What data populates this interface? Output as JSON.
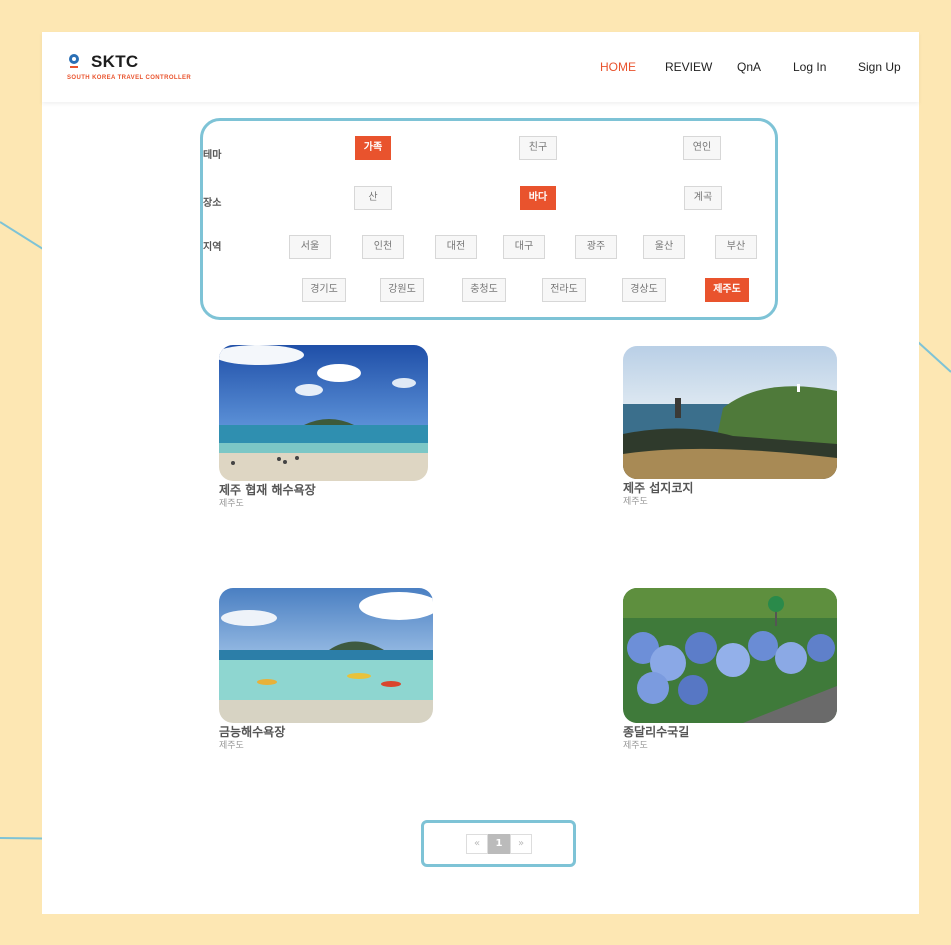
{
  "header": {
    "logo_title": "SKTC",
    "logo_subtitle": "SOUTH KOREA TRAVEL CONTROLLER",
    "nav": {
      "home": "HOME",
      "review": "REVIEW",
      "qna": "QnA",
      "login": "Log In",
      "signup": "Sign Up"
    },
    "active_nav": "HOME"
  },
  "filters": {
    "theme": {
      "label": "테마",
      "options": [
        "가족",
        "친구",
        "연인"
      ],
      "selected": "가족"
    },
    "place": {
      "label": "장소",
      "options": [
        "산",
        "바다",
        "계곡"
      ],
      "selected": "바다"
    },
    "region": {
      "label": "지역",
      "options_row1": [
        "서울",
        "인천",
        "대전",
        "대구",
        "광주",
        "울산",
        "부산"
      ],
      "options_row2": [
        "경기도",
        "강원도",
        "충청도",
        "전라도",
        "경상도",
        "제주도"
      ],
      "selected": "제주도"
    }
  },
  "results": [
    {
      "title": "제주 협재 해수욕장",
      "region": "제주도"
    },
    {
      "title": "제주 섭지코지",
      "region": "제주도"
    },
    {
      "title": "금능해수욕장",
      "region": "제주도"
    },
    {
      "title": "종달리수국길",
      "region": "제주도"
    }
  ],
  "pagination": {
    "prev": "«",
    "current": "1",
    "next": "»"
  },
  "colors": {
    "accent": "#e9532d",
    "background": "#fde7b3",
    "annotation": "#7ec3d6"
  }
}
